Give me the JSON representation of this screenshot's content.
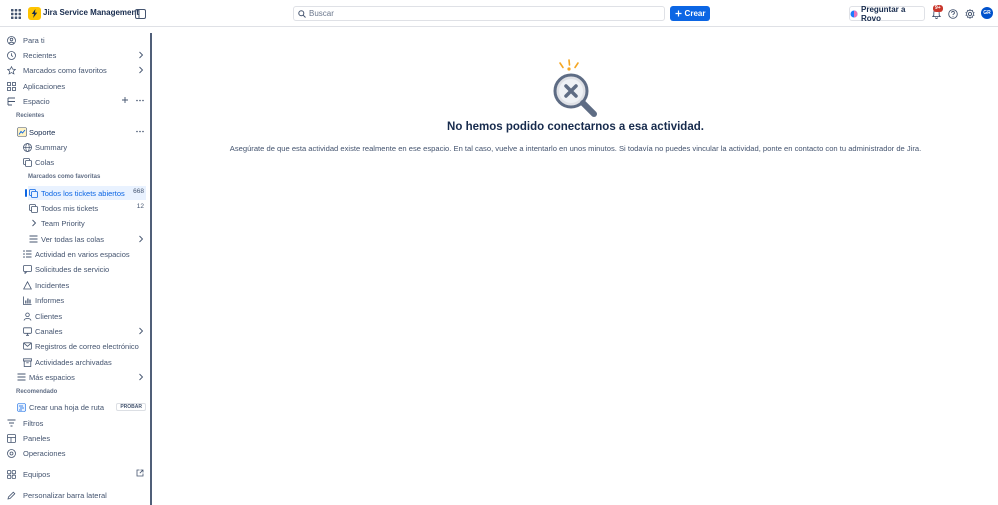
{
  "app": {
    "name": "Jira Service Management"
  },
  "topbar": {
    "search_placeholder": "Buscar",
    "create_label": "Crear",
    "rovo_label": "Preguntar a Rovo",
    "notifications_count": "9+",
    "avatar_initials": "GR"
  },
  "sidebar": {
    "for_you": "Para ti",
    "recent": "Recientes",
    "starred": "Marcados como favoritos",
    "apps": "Aplicaciones",
    "space": "Espacio",
    "recent_section": "Recientes",
    "project": "Soporte",
    "summary": "Summary",
    "queues": "Colas",
    "starred_section": "Marcados como favoritas",
    "queue_items": [
      {
        "label": "Todos los tickets abiertos",
        "count": "668"
      },
      {
        "label": "Todos mis tickets",
        "count": "12"
      }
    ],
    "team_priority": "Team Priority",
    "view_all_queues": "Ver todas las colas",
    "activity": "Actividad en varios espacios",
    "service_requests": "Solicitudes de servicio",
    "incidents": "Incidentes",
    "reports": "Informes",
    "customers": "Clientes",
    "channels": "Canales",
    "email_logs": "Registros de correo electrónico",
    "archived": "Actividades archivadas",
    "more_spaces": "Más espacios",
    "recommended_section": "Recomendado",
    "roadmap": "Crear una hoja de ruta",
    "try_label": "PROBAR",
    "filters": "Filtros",
    "dashboards": "Paneles",
    "operations": "Operaciones",
    "teams": "Equipos",
    "customize": "Personalizar barra lateral"
  },
  "main": {
    "title": "No hemos podido conectarnos a esa actividad.",
    "description": "Asegúrate de que esta actividad existe realmente en ese espacio. En tal caso, vuelve a intentarlo en unos minutos. Si todavía no puedes vincular la actividad, ponte en contacto con tu administrador de Jira."
  },
  "colors": {
    "primary": "#0c66e4",
    "brand": "#ffc400",
    "text": "#172b4d",
    "subtle": "#44546f"
  },
  "icons": [
    "app-switcher-icon",
    "sidebar-toggle-icon",
    "search-icon",
    "plus-icon",
    "rovo-icon",
    "bell-icon",
    "help-icon",
    "settings-icon",
    "magnifier-x-icon"
  ]
}
